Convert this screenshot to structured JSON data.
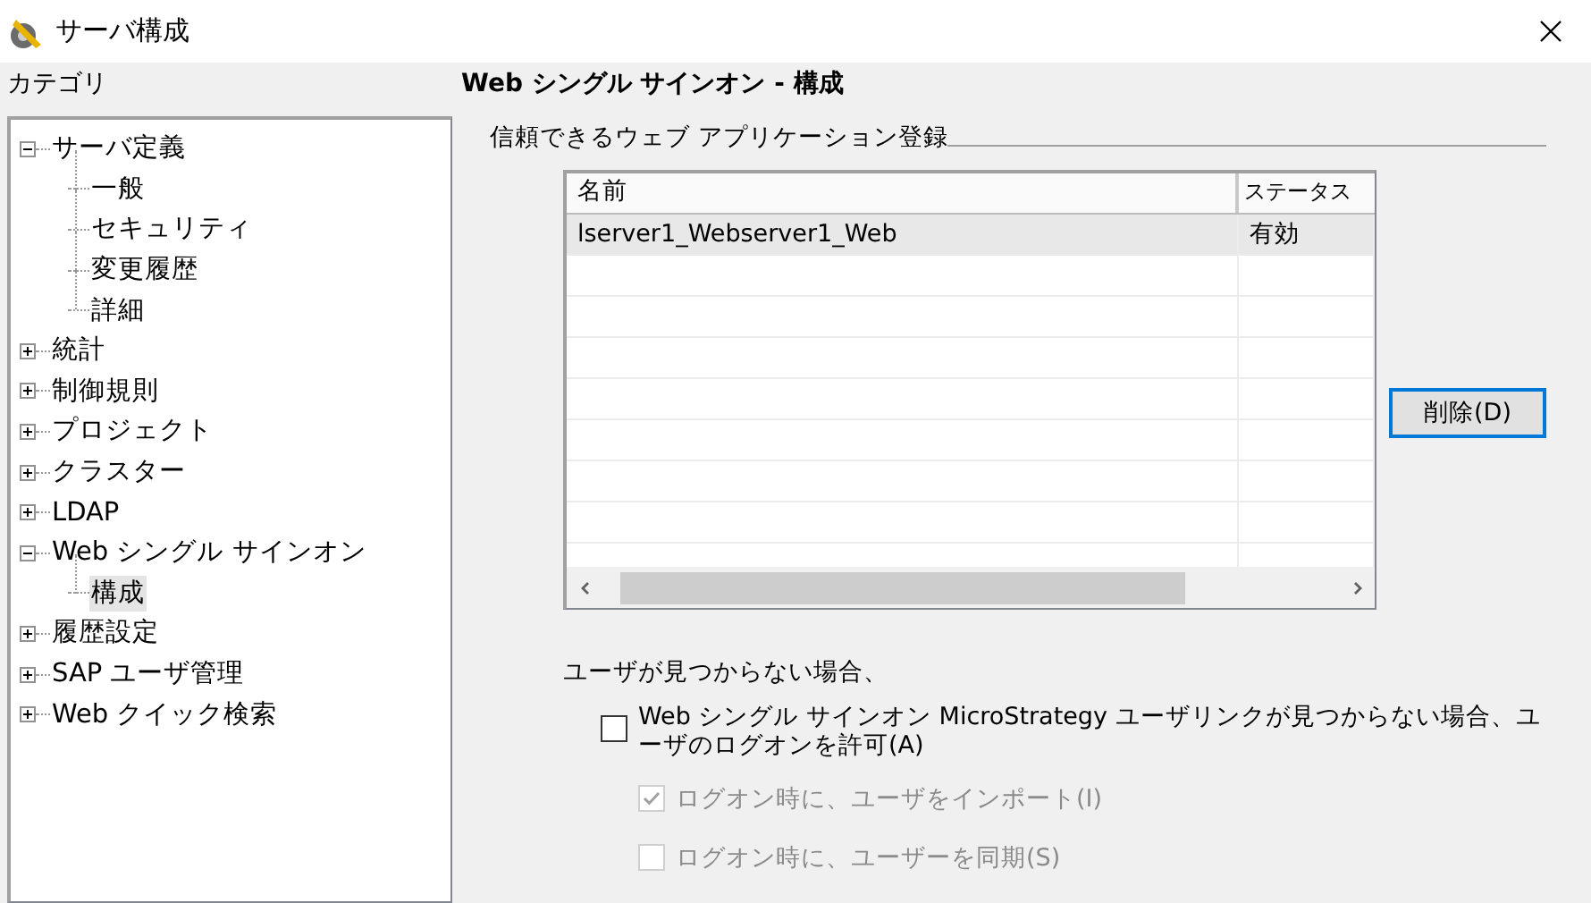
{
  "window": {
    "title": "サーバ構成"
  },
  "sidebar": {
    "label": "カテゴリ",
    "tree": [
      {
        "label": "サーバ定義",
        "expanded": true,
        "selected": false,
        "children": [
          {
            "label": "一般",
            "selected": false
          },
          {
            "label": "セキュリティ",
            "selected": false
          },
          {
            "label": "変更履歴",
            "selected": false
          },
          {
            "label": "詳細",
            "selected": false
          }
        ]
      },
      {
        "label": "統計",
        "expanded": false,
        "selected": false
      },
      {
        "label": "制御規則",
        "expanded": false,
        "selected": false
      },
      {
        "label": "プロジェクト",
        "expanded": false,
        "selected": false
      },
      {
        "label": "クラスター",
        "expanded": false,
        "selected": false
      },
      {
        "label": "LDAP",
        "expanded": false,
        "selected": false
      },
      {
        "label": "Web シングル サインオン",
        "expanded": true,
        "selected": false,
        "children": [
          {
            "label": "構成",
            "selected": true
          }
        ]
      },
      {
        "label": "履歴設定",
        "expanded": false,
        "selected": false
      },
      {
        "label": "SAP ユーザ管理",
        "expanded": false,
        "selected": false
      },
      {
        "label": "Web クイック検索",
        "expanded": false,
        "selected": false
      }
    ]
  },
  "panel": {
    "heading": "Web シングル サインオン - 構成",
    "group_label": "信頼できるウェブ アプリケーション登録",
    "table": {
      "columns": [
        "名前",
        "ステータス"
      ],
      "rows": [
        {
          "cells": [
            "lserver1_Webserver1_Web",
            "有効"
          ],
          "selected": true
        }
      ]
    },
    "delete_button": "削除(D)",
    "options_label": "ユーザが見つからない場合、",
    "options": [
      {
        "label": "Web シングル サインオン MicroStrategy ユーザリンクが見つからない場合、ユーザのログオンを許可(A)",
        "checked": false,
        "disabled": false
      },
      {
        "label": "ログオン時に、ユーザをインポート(I)",
        "checked": true,
        "disabled": true
      },
      {
        "label": "ログオン時に、ユーザーを同期(S)",
        "checked": false,
        "disabled": true
      }
    ]
  }
}
